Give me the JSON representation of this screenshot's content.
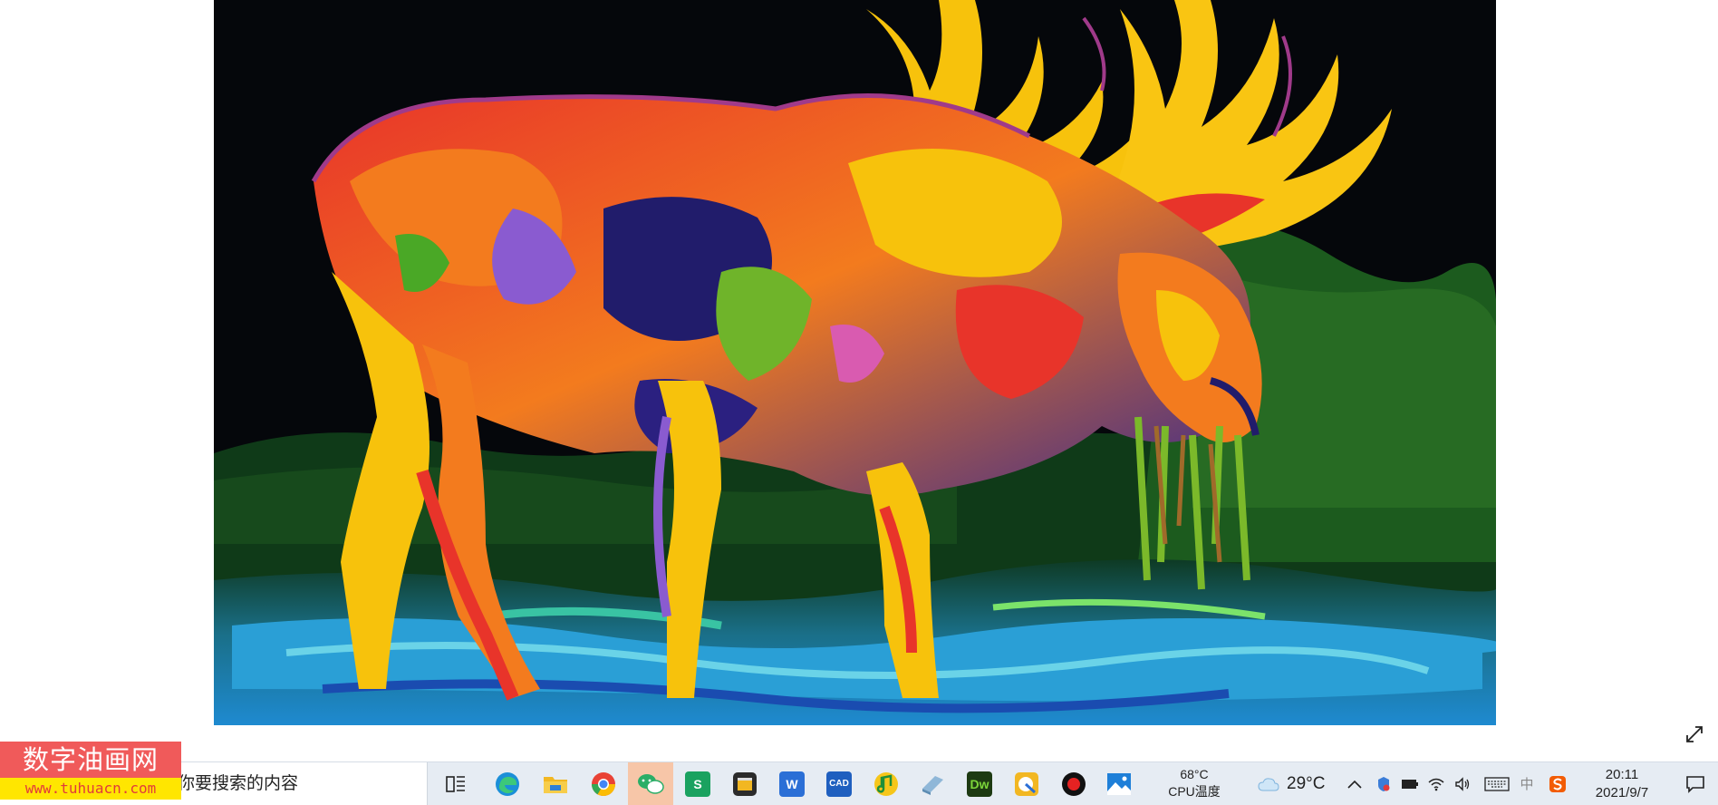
{
  "viewer": {
    "image_description_icon": "image",
    "expand_icon": "expand-diagonal-icon"
  },
  "watermark": {
    "title": "数字油画网",
    "url": "www.tuhuacn.com"
  },
  "taskbar": {
    "search_placeholder": "你要搜索的内容",
    "apps": [
      {
        "name": "task-view",
        "icon": "task-view-icon"
      },
      {
        "name": "edge",
        "icon": "edge-browser-icon"
      },
      {
        "name": "file-explorer",
        "icon": "folder-icon"
      },
      {
        "name": "chrome",
        "icon": "chrome-icon"
      },
      {
        "name": "wechat",
        "icon": "wechat-icon",
        "active": true
      },
      {
        "name": "wps-sheets",
        "icon": "s-app-icon",
        "label": "S"
      },
      {
        "name": "clapper",
        "icon": "video-clapper-icon"
      },
      {
        "name": "word",
        "icon": "word-icon",
        "label": "W"
      },
      {
        "name": "cad",
        "icon": "cad-icon",
        "label": "CAD"
      },
      {
        "name": "music",
        "icon": "music-icon"
      },
      {
        "name": "book",
        "icon": "book-icon"
      },
      {
        "name": "dreamweaver",
        "icon": "dreamweaver-icon",
        "label": "Dw"
      },
      {
        "name": "paint",
        "icon": "paint-icon"
      },
      {
        "name": "recorder",
        "icon": "record-icon"
      },
      {
        "name": "photos",
        "icon": "photos-icon"
      }
    ],
    "cpu_temp": "68°C",
    "cpu_label": "CPU温度",
    "weather_temp": "29°C",
    "ime_label": "中",
    "clock_time": "20:11",
    "clock_date": "2021/9/7"
  }
}
